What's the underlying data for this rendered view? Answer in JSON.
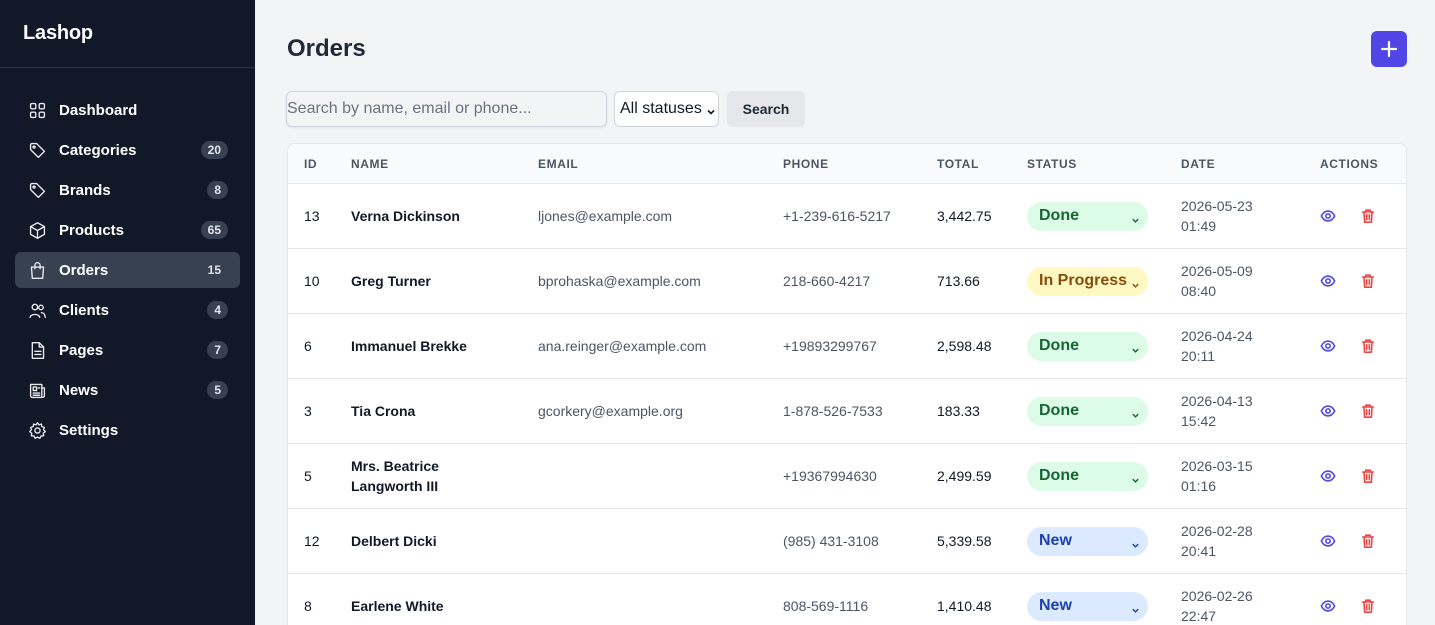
{
  "app": {
    "brand": "Lashop"
  },
  "sidebar": {
    "items": [
      {
        "label": "Dashboard",
        "icon": "grid-icon",
        "badge": ""
      },
      {
        "label": "Categories",
        "icon": "tag-icon",
        "badge": "20"
      },
      {
        "label": "Brands",
        "icon": "tag-icon",
        "badge": "8"
      },
      {
        "label": "Products",
        "icon": "cube-icon",
        "badge": "65"
      },
      {
        "label": "Orders",
        "icon": "shopping-bag-icon",
        "badge": "15",
        "active": true
      },
      {
        "label": "Clients",
        "icon": "users-icon",
        "badge": "4"
      },
      {
        "label": "Pages",
        "icon": "document-icon",
        "badge": "7"
      },
      {
        "label": "News",
        "icon": "newspaper-icon",
        "badge": "5"
      },
      {
        "label": "Settings",
        "icon": "gear-icon",
        "badge": ""
      }
    ]
  },
  "page": {
    "title": "Orders"
  },
  "filters": {
    "search_placeholder": "Search by name, email or phone...",
    "search_value": "",
    "status_selected": "All statuses",
    "search_button": "Search"
  },
  "colors": {
    "sidebar_bg": "#111827",
    "accent": "#4f46e5",
    "done": "#dcfce7",
    "in_progress": "#fef9c3",
    "new": "#dbeafe",
    "danger": "#ef4444"
  },
  "table": {
    "headers": [
      "ID",
      "NAME",
      "EMAIL",
      "PHONE",
      "TOTAL",
      "STATUS",
      "DATE",
      "ACTIONS"
    ],
    "rows": [
      {
        "id": "13",
        "name": "Verna Dickinson",
        "email": "ljones@example.com",
        "phone": "+1-239-616-5217",
        "total": "3,442.75",
        "status": "Done",
        "date": "2026-05-23",
        "time": "01:49"
      },
      {
        "id": "10",
        "name": "Greg Turner",
        "email": "bprohaska@example.com",
        "phone": "218-660-4217",
        "total": "713.66",
        "status": "In Progress",
        "date": "2026-05-09",
        "time": "08:40"
      },
      {
        "id": "6",
        "name": "Immanuel Brekke",
        "email": "ana.reinger@example.com",
        "phone": "+19893299767",
        "total": "2,598.48",
        "status": "Done",
        "date": "2026-04-24",
        "time": "20:11"
      },
      {
        "id": "3",
        "name": "Tia Crona",
        "email": "gcorkery@example.org",
        "phone": "1-878-526-7533",
        "total": "183.33",
        "status": "Done",
        "date": "2026-04-13",
        "time": "15:42"
      },
      {
        "id": "5",
        "name": "Mrs. Beatrice Langworth III",
        "email": "",
        "phone": "+19367994630",
        "total": "2,499.59",
        "status": "Done",
        "date": "2026-03-15",
        "time": "01:16"
      },
      {
        "id": "12",
        "name": "Delbert Dicki",
        "email": "",
        "phone": "(985) 431-3108",
        "total": "5,339.58",
        "status": "New",
        "date": "2026-02-28",
        "time": "20:41"
      },
      {
        "id": "8",
        "name": "Earlene White",
        "email": "",
        "phone": "808-569-1116",
        "total": "1,410.48",
        "status": "New",
        "date": "2026-02-26",
        "time": "22:47"
      }
    ]
  }
}
